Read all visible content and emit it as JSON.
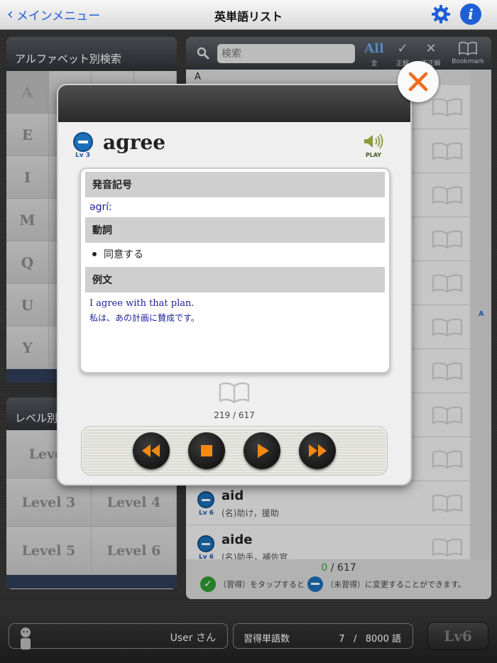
{
  "nav": {
    "back_label": "メインメニュー",
    "title": "英単語リスト",
    "settings_icon": "gear-icon",
    "info_icon": "info-icon",
    "info_glyph": "i"
  },
  "alphabet_panel": {
    "title": "アルファベット別検索",
    "rows": [
      [
        "A",
        "",
        "",
        ""
      ],
      [
        "E",
        "",
        "",
        ""
      ],
      [
        "I",
        "",
        "",
        ""
      ],
      [
        "M",
        "",
        "",
        ""
      ],
      [
        "Q",
        "",
        "",
        ""
      ],
      [
        "U",
        "",
        "",
        ""
      ],
      [
        "Y",
        "",
        "",
        ""
      ]
    ]
  },
  "level_panel": {
    "title": "レベル別",
    "cells": [
      "Level",
      "",
      "Level 3",
      "Level 4",
      "Level 5",
      "Level 6"
    ]
  },
  "list_panel": {
    "search_placeholder": "検索",
    "filters": [
      {
        "glyph": "All",
        "label": "全"
      },
      {
        "glyph": "✓",
        "label": "正解"
      },
      {
        "glyph": "✕",
        "label": "不正解"
      },
      {
        "glyph": "📖",
        "label": "Bookmark"
      }
    ],
    "section_header": "A",
    "index_letter": "A",
    "rows": [
      {
        "lv": "Lv 6",
        "word": "aid",
        "definition": "(名)助け，援助"
      },
      {
        "lv": "Lv 6",
        "word": "aide",
        "definition": "(名)助手，補佐官"
      }
    ],
    "count": {
      "learned": "0",
      "separator": "/",
      "total": "617"
    },
    "hint": {
      "part1": "（習得）をタップすると",
      "part2": "（未習得）に変更することができます。"
    }
  },
  "bottom_bar": {
    "user_name": "User さん",
    "learned_label": "習得単語数",
    "learned_count": "7",
    "separator": "/",
    "total_words": "8000 語",
    "level_button": "Lv6"
  },
  "modal": {
    "level": "Lv 3",
    "word": "agree",
    "play_label": "PLAY",
    "sections": {
      "pronunciation_header": "発音記号",
      "pronunciation": "əgríː",
      "pos_header": "動詞",
      "meaning": "同意する",
      "example_header": "例文",
      "example_en": "I agree with that plan.",
      "example_ja": "私は、あの計画に賛成です。"
    },
    "position": "219 / 617",
    "controls": [
      "rewind-icon",
      "stop-icon",
      "play-icon",
      "fast-forward-icon"
    ]
  },
  "colors": {
    "accent_blue": "#1f5fd6",
    "close_orange": "#f26a1b",
    "control_orange": "#f28a14",
    "learned_green": "#2aa52a"
  }
}
